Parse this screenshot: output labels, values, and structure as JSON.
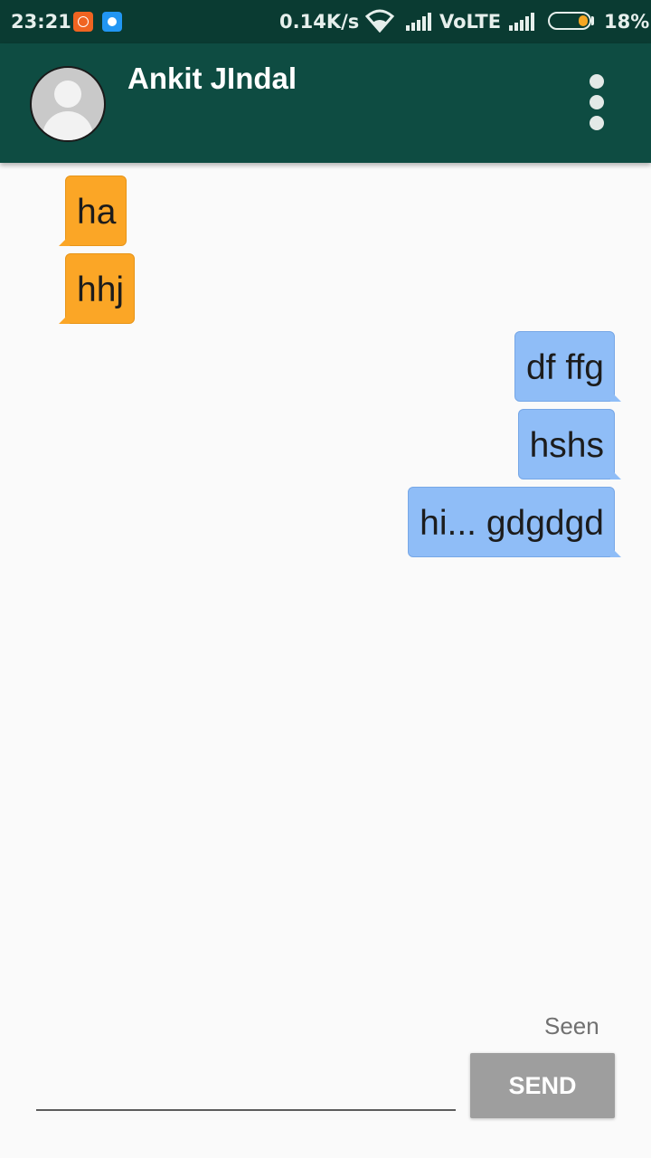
{
  "status_bar": {
    "time": "23:21",
    "network_speed": "0.14K/s",
    "network_type": "VoLTE",
    "battery_percent": "18%",
    "battery_level": 0.18,
    "icons": [
      "mi-notification-icon",
      "app-notification-icon",
      "wifi-icon",
      "signal-icon",
      "signal-icon-2",
      "battery-icon"
    ]
  },
  "app_bar": {
    "contact_name": "Ankit JIndal",
    "avatar_icon": "person-placeholder-icon",
    "menu_icon": "more-vert-icon",
    "background_color": "#0e4c42"
  },
  "messages": [
    {
      "text": "ha",
      "direction": "incoming"
    },
    {
      "text": "hhj",
      "direction": "incoming"
    },
    {
      "text": "df ffg",
      "direction": "outgoing"
    },
    {
      "text": "hshs",
      "direction": "outgoing"
    },
    {
      "text": "hi... gdgdgd",
      "direction": "outgoing"
    }
  ],
  "colors": {
    "incoming_bubble": "#fba626",
    "outgoing_bubble": "#8fbdf7"
  },
  "composer": {
    "seen_label": "Seen",
    "input_value": "",
    "send_label": "SEND"
  }
}
